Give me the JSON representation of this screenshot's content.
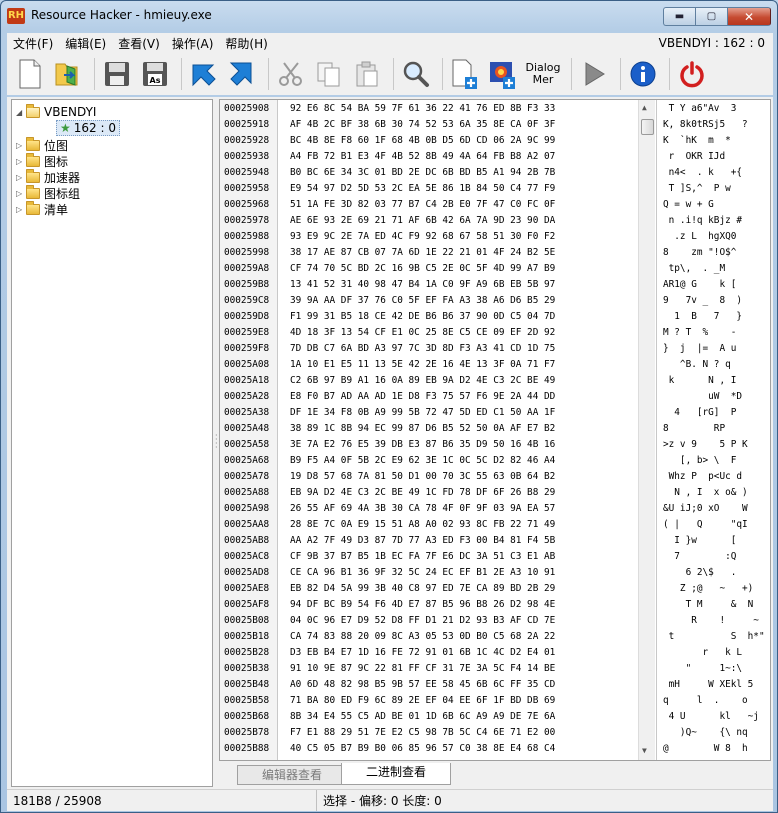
{
  "window": {
    "title": "Resource Hacker - hmieuy.exe",
    "icon_text": "RH",
    "min_glyph": "▬",
    "max_glyph": "▢",
    "close_glyph": "✕"
  },
  "menu": {
    "items": [
      "文件(F)",
      "编辑(E)",
      "查看(V)",
      "操作(A)",
      "帮助(H)"
    ],
    "resource_indicator": "VBENDYI : 162 : 0"
  },
  "toolbar": {
    "dialog_label_1": "Dialog",
    "dialog_label_2": "Mer"
  },
  "tree": {
    "root": "VBENDYI",
    "root_child": "162 : 0",
    "items": [
      "位图",
      "图标",
      "加速器",
      "图标组",
      "清单"
    ]
  },
  "hex": {
    "rows": [
      {
        "addr": "00025908",
        "bytes": "92 E6 8C 54 BA 59 7F 61 36 22 41 76 ED 8B F3 33",
        "ascii": " T Y a6\"Av  3"
      },
      {
        "addr": "00025918",
        "bytes": "AF 4B 2C BF 38 6B 30 74 52 53 6A 35 8E CA 0F 3F",
        "ascii": "K, 8k0tRSj5   ?"
      },
      {
        "addr": "00025928",
        "bytes": "BC 4B 8E F8 60 1F 68 4B 0B D5 6D CD 06 2A 9C 99",
        "ascii": "K  `hK  m  *"
      },
      {
        "addr": "00025938",
        "bytes": "A4 FB 72 B1 E3 4F 4B 52 8B 49 4A 64 FB B8 A2 07",
        "ascii": " r  OKR IJd"
      },
      {
        "addr": "00025948",
        "bytes": "B0 BC 6E 34 3C 01 BD 2E DC 6B BD B5 A1 94 2B 7B",
        "ascii": " n4<  . k   +{"
      },
      {
        "addr": "00025958",
        "bytes": "E9 54 97 D2 5D 53 2C EA 5E 86 1B 84 50 C4 77 F9",
        "ascii": " T ]S,^  P w"
      },
      {
        "addr": "00025968",
        "bytes": "51 1A FE 3D 82 03 77 B7 C4 2B E0 7F 47 C0 FC 0F",
        "ascii": "Q = w + G"
      },
      {
        "addr": "00025978",
        "bytes": "AE 6E 93 2E 69 21 71 AF 6B 42 6A 7A 9D 23 90 DA",
        "ascii": " n .i!q kBjz #"
      },
      {
        "addr": "00025988",
        "bytes": "93 E9 9C 2E 7A ED 4C F9 92 68 67 58 51 30 F0 F2",
        "ascii": "  .z L  hgXQ0"
      },
      {
        "addr": "00025998",
        "bytes": "38 17 AE 87 CB 07 7A 6D 1E 22 21 01 4F 24 B2 5E",
        "ascii": "8    zm \"!O$^"
      },
      {
        "addr": "000259A8",
        "bytes": "CF 74 70 5C BD 2C 16 9B C5 2E 0C 5F 4D 99 A7 B9",
        "ascii": " tp\\,  . _M"
      },
      {
        "addr": "000259B8",
        "bytes": "13 41 52 31 40 98 47 B4 1A C0 9F A9 6B EB 5B 97",
        "ascii": "AR1@ G    k ["
      },
      {
        "addr": "000259C8",
        "bytes": "39 9A AA DF 37 76 C0 5F EF FA A3 38 A6 D6 B5 29",
        "ascii": "9   7v _  8  )"
      },
      {
        "addr": "000259D8",
        "bytes": "F1 99 31 B5 18 CE 42 DE B6 B6 37 90 0D C5 04 7D",
        "ascii": "  1  B   7   }"
      },
      {
        "addr": "000259E8",
        "bytes": "4D 18 3F 13 54 CF E1 0C 25 8E C5 CE 09 EF 2D 92",
        "ascii": "M ? T  %    -"
      },
      {
        "addr": "000259F8",
        "bytes": "7D DB C7 6A BD A3 97 7C 3D 8D F3 A3 41 CD 1D 75",
        "ascii": "}  j  |=  A u"
      },
      {
        "addr": "00025A08",
        "bytes": "1A 10 E1 E5 11 13 5E 42 2E 16 4E 13 3F 0A 71 F7",
        "ascii": "   ^B. N ? q"
      },
      {
        "addr": "00025A18",
        "bytes": "C2 6B 97 B9 A1 16 0A 89 EB 9A D2 4E C3 2C BE 49",
        "ascii": " k      N , I"
      },
      {
        "addr": "00025A28",
        "bytes": "E8 F0 B7 AD AA AD 1E D8 F3 75 57 F6 9E 2A 44 DD",
        "ascii": "        uW  *D"
      },
      {
        "addr": "00025A38",
        "bytes": "DF 1E 34 F8 0B A9 99 5B 72 47 5D ED C1 50 AA 1F",
        "ascii": "  4   [rG]  P"
      },
      {
        "addr": "00025A48",
        "bytes": "38 89 1C 8B 94 EC 99 87 D6 B5 52 50 0A AF E7 B2",
        "ascii": "8        RP"
      },
      {
        "addr": "00025A58",
        "bytes": "3E 7A E2 76 E5 39 DB E3 87 B6 35 D9 50 16 4B 16",
        "ascii": ">z v 9    5 P K"
      },
      {
        "addr": "00025A68",
        "bytes": "B9 F5 A4 0F 5B 2C E9 62 3E 1C 0C 5C D2 82 46 A4",
        "ascii": "   [, b> \\  F"
      },
      {
        "addr": "00025A78",
        "bytes": "19 D8 57 68 7A 81 50 D1 00 70 3C 55 63 0B 64 B2",
        "ascii": " Whz P  p<Uc d"
      },
      {
        "addr": "00025A88",
        "bytes": "EB 9A D2 4E C3 2C BE 49 1C FD 78 DF 6F 26 B8 29",
        "ascii": "  N , I  x o& )"
      },
      {
        "addr": "00025A98",
        "bytes": "26 55 AF 69 4A 3B 30 CA 78 4F 0F 9F 03 9A EA 57",
        "ascii": "&U iJ;0 xO    W"
      },
      {
        "addr": "00025AA8",
        "bytes": "28 8E 7C 0A E9 15 51 A8 A0 02 93 8C FB 22 71 49",
        "ascii": "( |   Q     \"qI"
      },
      {
        "addr": "00025AB8",
        "bytes": "AA A2 7F 49 D3 87 7D 77 A3 ED F3 00 B4 81 F4 5B",
        "ascii": "  I }w      ["
      },
      {
        "addr": "00025AC8",
        "bytes": "CF 9B 37 B7 B5 1B EC FA 7F E6 DC 3A 51 C3 E1 AB",
        "ascii": "  7        :Q"
      },
      {
        "addr": "00025AD8",
        "bytes": "CE CA 96 B1 36 9F 32 5C 24 EC EF B1 2E A3 10 91",
        "ascii": "    6 2\\$   ."
      },
      {
        "addr": "00025AE8",
        "bytes": "EB 82 D4 5A 99 3B 40 C8 97 ED 7E CA 89 BD 2B 29",
        "ascii": "   Z ;@   ~   +)"
      },
      {
        "addr": "00025AF8",
        "bytes": "94 DF BC B9 54 F6 4D E7 87 B5 96 B8 26 D2 98 4E",
        "ascii": "    T M     &  N"
      },
      {
        "addr": "00025B08",
        "bytes": "04 0C 96 E7 D9 52 D8 FF D1 21 D2 93 B3 AF CD 7E",
        "ascii": "     R    !     ~"
      },
      {
        "addr": "00025B18",
        "bytes": "CA 74 83 88 20 09 8C A3 05 53 0D B0 C5 68 2A 22",
        "ascii": " t          S  h*\""
      },
      {
        "addr": "00025B28",
        "bytes": "D3 EB B4 E7 1D 16 FE 72 91 01 6B 1C 4C D2 E4 01",
        "ascii": "       r   k L"
      },
      {
        "addr": "00025B38",
        "bytes": "91 10 9E 87 9C 22 81 FF CF 31 7E 3A 5C F4 14 BE",
        "ascii": "    \"     1~:\\"
      },
      {
        "addr": "00025B48",
        "bytes": "A0 6D 48 82 98 B5 9B 57 EE 58 45 6B 6C FF 35 CD",
        "ascii": " mH     W XEkl 5"
      },
      {
        "addr": "00025B58",
        "bytes": "71 BA 80 ED F9 6C 89 2E EF 04 EE 6F 1F BD DB 69",
        "ascii": "q     l  .    o"
      },
      {
        "addr": "00025B68",
        "bytes": "8B 34 E4 55 C5 AD BE 01 1D 6B 6C A9 A9 DE 7E 6A",
        "ascii": " 4 U      kl   ~j"
      },
      {
        "addr": "00025B78",
        "bytes": "F7 E1 88 29 51 7E E2 C5 98 7B 5C C4 6E 71 E2 00",
        "ascii": "   )Q~    {\\ nq"
      },
      {
        "addr": "00025B88",
        "bytes": "40 C5 05 B7 B9 B0 06 85 96 57 C0 38 8E E4 68 C4",
        "ascii": "@        W 8  h"
      }
    ]
  },
  "tabs": {
    "editor_view": "编辑器查看",
    "binary_view": "二进制查看"
  },
  "status": {
    "position": "181B8 / 25908",
    "selection": "选择 - 偏移: 0 长度: 0"
  },
  "colors": {
    "accent": "#1e7fd6",
    "play_gray": "#8a8a8a",
    "power_red": "#d21f1f"
  }
}
